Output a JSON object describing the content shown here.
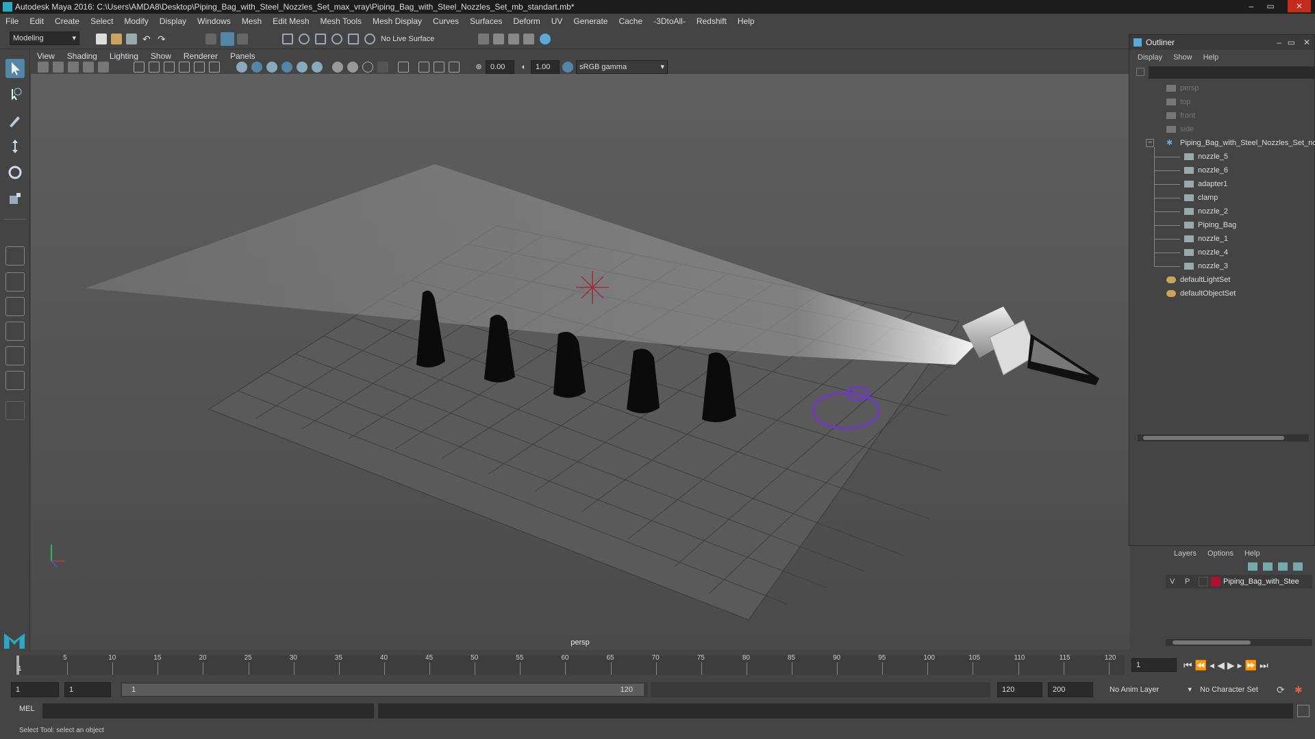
{
  "window": {
    "title": "Autodesk Maya 2016: C:\\Users\\AMDA8\\Desktop\\Piping_Bag_with_Steel_Nozzles_Set_max_vray\\Piping_Bag_with_Steel_Nozzles_Set_mb_standart.mb*",
    "minimize": "–",
    "maximize": "▭",
    "close": "✕"
  },
  "menubar": [
    "File",
    "Edit",
    "Create",
    "Select",
    "Modify",
    "Display",
    "Windows",
    "Mesh",
    "Edit Mesh",
    "Mesh Tools",
    "Mesh Display",
    "Curves",
    "Surfaces",
    "Deform",
    "UV",
    "Generate",
    "Cache",
    "-3DtoAll-",
    "Redshift",
    "Help"
  ],
  "shelf": {
    "mode": "Modeling",
    "live_surface": "No Live Surface"
  },
  "viewport_menu": [
    "View",
    "Shading",
    "Lighting",
    "Show",
    "Renderer",
    "Panels"
  ],
  "viewport_toolbar": {
    "exposure": "0.00",
    "gamma": "1.00",
    "color_space": "sRGB gamma"
  },
  "viewport": {
    "camera_label": "persp"
  },
  "outliner": {
    "title": "Outliner",
    "menu": [
      "Display",
      "Show",
      "Help"
    ],
    "items": [
      {
        "label": "persp",
        "level": 0,
        "dim": true,
        "icon": "camera-icon"
      },
      {
        "label": "top",
        "level": 0,
        "dim": true,
        "icon": "camera-icon"
      },
      {
        "label": "front",
        "level": 0,
        "dim": true,
        "icon": "camera-icon"
      },
      {
        "label": "side",
        "level": 0,
        "dim": true,
        "icon": "camera-icon"
      },
      {
        "label": "Piping_Bag_with_Steel_Nozzles_Set_nc",
        "level": 0,
        "dim": false,
        "icon": "group-icon"
      },
      {
        "label": "nozzle_5",
        "level": 1,
        "dim": false,
        "icon": "mesh-icon"
      },
      {
        "label": "nozzle_6",
        "level": 1,
        "dim": false,
        "icon": "mesh-icon"
      },
      {
        "label": "adapter1",
        "level": 1,
        "dim": false,
        "icon": "mesh-icon"
      },
      {
        "label": "clamp",
        "level": 1,
        "dim": false,
        "icon": "mesh-icon"
      },
      {
        "label": "nozzle_2",
        "level": 1,
        "dim": false,
        "icon": "mesh-icon"
      },
      {
        "label": "Piping_Bag",
        "level": 1,
        "dim": false,
        "icon": "mesh-icon"
      },
      {
        "label": "nozzle_1",
        "level": 1,
        "dim": false,
        "icon": "mesh-icon"
      },
      {
        "label": "nozzle_4",
        "level": 1,
        "dim": false,
        "icon": "mesh-icon"
      },
      {
        "label": "nozzle_3",
        "level": 1,
        "dim": false,
        "icon": "mesh-icon"
      },
      {
        "label": "defaultLightSet",
        "level": 0,
        "dim": false,
        "icon": "set-icon"
      },
      {
        "label": "defaultObjectSet",
        "level": 0,
        "dim": false,
        "icon": "set-icon"
      }
    ]
  },
  "layers": {
    "menu": [
      "Layers",
      "Options",
      "Help"
    ],
    "row": {
      "v": "V",
      "p": "P",
      "name": "Piping_Bag_with_Stee",
      "color": "#b01030"
    }
  },
  "timeline": {
    "ticks": [
      "5",
      "10",
      "15",
      "20",
      "25",
      "30",
      "35",
      "40",
      "45",
      "50",
      "55",
      "60",
      "65",
      "70",
      "75",
      "80",
      "85",
      "90",
      "95",
      "100",
      "105",
      "110",
      "115",
      "120"
    ],
    "current_frame": "1",
    "current_marker": "1"
  },
  "range": {
    "start": "1",
    "playback_start": "1",
    "slider_start": "1",
    "slider_end": "120",
    "playback_end": "120",
    "end": "200",
    "anim_layer": "No Anim Layer",
    "char_set": "No Character Set"
  },
  "cmdline": {
    "lang": "MEL"
  },
  "helpline": {
    "text": "Select Tool: select an object"
  },
  "colors": {
    "accent": "#5285a6",
    "ring": "#6a3fb0",
    "grid": "#3f3f3f"
  }
}
